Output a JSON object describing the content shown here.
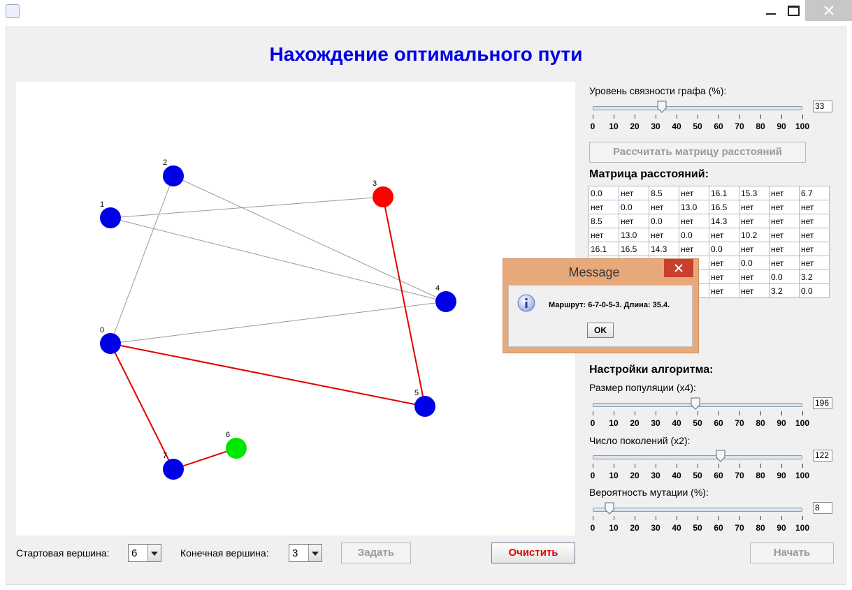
{
  "window": {
    "app_icon": "java-icon",
    "controls": [
      "minimize-icon",
      "maximize-icon",
      "close-icon"
    ]
  },
  "title": "Нахождение оптимального пути",
  "graph": {
    "node_color_default": "#0000e6",
    "start_color": "#00e600",
    "end_color": "#ff0000",
    "edge_color": "#999999",
    "path_color": "#e00000",
    "nodes": [
      {
        "id": "0",
        "label": "0",
        "status": "default"
      },
      {
        "id": "1",
        "label": "1",
        "status": "default"
      },
      {
        "id": "2",
        "label": "2",
        "status": "default"
      },
      {
        "id": "3",
        "label": "3",
        "status": "end"
      },
      {
        "id": "4",
        "label": "4",
        "status": "default"
      },
      {
        "id": "5",
        "label": "5",
        "status": "default"
      },
      {
        "id": "6",
        "label": "6",
        "status": "start"
      },
      {
        "id": "7",
        "label": "7",
        "status": "default"
      }
    ],
    "edges": [
      [
        2,
        0
      ],
      [
        2,
        4
      ],
      [
        1,
        3
      ],
      [
        1,
        4
      ],
      [
        0,
        4
      ]
    ],
    "path_edges": [
      [
        6,
        7
      ],
      [
        7,
        0
      ],
      [
        0,
        5
      ],
      [
        5,
        3
      ]
    ]
  },
  "bottom": {
    "start_label": "Стартовая вершина:",
    "start_value": "6",
    "end_label": "Конечная вершина:",
    "end_value": "3",
    "set_button": "Задать",
    "clear_button": "Очистить",
    "start_button": "Начать"
  },
  "connectivity": {
    "label": "Уровень связности графа (%):",
    "value": "33",
    "level_percent": 33
  },
  "tick_labels": [
    "0",
    "10",
    "20",
    "30",
    "40",
    "50",
    "60",
    "70",
    "80",
    "90",
    "100"
  ],
  "calc_button": "Рассчитать матрицу расстояний",
  "matrix_title": "Матрица расстояний:",
  "matrix": [
    [
      "0.0",
      "нет",
      "8.5",
      "нет",
      "16.1",
      "15.3",
      "нет",
      "6.7"
    ],
    [
      "нет",
      "0.0",
      "нет",
      "13.0",
      "16.5",
      "нет",
      "нет",
      "нет"
    ],
    [
      "8.5",
      "нет",
      "0.0",
      "нет",
      "14.3",
      "нет",
      "нет",
      "нет"
    ],
    [
      "нет",
      "13.0",
      "нет",
      "0.0",
      "нет",
      "10.2",
      "нет",
      "нет"
    ],
    [
      "16.1",
      "16.5",
      "14.3",
      "нет",
      "0.0",
      "нет",
      "нет",
      "нет"
    ],
    [
      "15.3",
      "нет",
      "нет",
      "10.2",
      "нет",
      "0.0",
      "нет",
      "нет"
    ],
    [
      "нет",
      "нет",
      "нет",
      "нет",
      "нет",
      "нет",
      "0.0",
      "3.2"
    ],
    [
      "6.7",
      "нет",
      "нет",
      "нет",
      "нет",
      "нет",
      "3.2",
      "0.0"
    ]
  ],
  "algorithm": {
    "title": "Настройки алгоритма:",
    "population": {
      "label": "Размер популяции (x4):",
      "value": "196",
      "level_percent": 49
    },
    "generations": {
      "label": "Число поколений (x2):",
      "value": "122",
      "level_percent": 61
    },
    "mutation": {
      "label": "Вероятность мутации (%):",
      "value": "8",
      "level_percent": 8
    }
  },
  "dialog": {
    "title": "Message",
    "icon": "info-icon",
    "message": "Маршрут: 6-7-0-5-3. Длина: 35.4.",
    "ok": "OK"
  }
}
